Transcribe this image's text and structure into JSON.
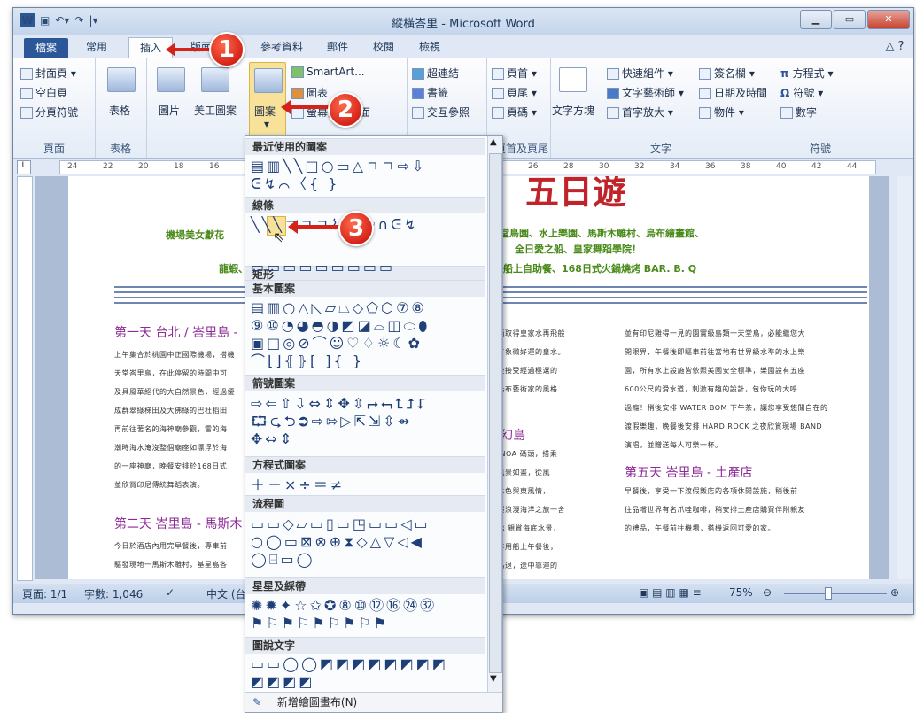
{
  "window": {
    "title": "縱橫峇里 - Microsoft Word"
  },
  "tabs": [
    "檔案",
    "常用",
    "插入",
    "版面配置",
    "參考資料",
    "郵件",
    "校閱",
    "檢視"
  ],
  "ribbon": {
    "page_group": {
      "label": "頁面",
      "items": [
        "封面頁",
        "空白頁",
        "分頁符號"
      ]
    },
    "table_group": {
      "label": "表格",
      "items": [
        "表格"
      ]
    },
    "illus_group": {
      "items": [
        "圖片",
        "美工圖案",
        "圖案",
        "SmartArt...",
        "圖表",
        "螢幕擷取畫面"
      ]
    },
    "links_group": {
      "items": [
        "超連結",
        "書籤",
        "交互參照"
      ]
    },
    "header_group": {
      "label": "頁首及頁尾",
      "items": [
        "頁首",
        "頁尾",
        "頁碼"
      ]
    },
    "text_group": {
      "label": "文字",
      "items": [
        "文字方塊",
        "快速組件",
        "文字藝術師",
        "首字放大",
        "簽名欄",
        "日期及時間",
        "物件"
      ]
    },
    "symbol_group": {
      "label": "符號",
      "items": [
        "方程式",
        "符號",
        "數字"
      ]
    }
  },
  "ruler": {
    "labels": [
      "24",
      "22",
      "20",
      "18",
      "16",
      "14",
      "12",
      "10",
      "14",
      "16",
      "18",
      "22",
      "24",
      "26",
      "28",
      "30",
      "32",
      "34",
      "36",
      "38",
      "40",
      "42",
      "44"
    ]
  },
  "document": {
    "big_title": "五日遊",
    "intro1": "機場美女獻花",
    "intro1b": "天堂鳥園、水上樂園、馬斯木雕村、烏布繪畫館、",
    "intro2": "全日愛之船、皇家舞蹈學院！",
    "intro3a": "龍蝦、",
    "intro3b": "、船上自助餐、168日式火鍋燒烤 BAR. B. Q",
    "day1": "第一天 台北 / 峇里島 -",
    "day2": "第二天 峇里島 - 馬斯木",
    "day5": "第五天 峇里島 - 土產店",
    "dream": "夢幻島",
    "col1": [
      "上午集合於桃園中正國際機場，搭機",
      "天堂峇里島，在此停留的時間中可",
      "及具風華絕代的大自然景色，經過優",
      "成群翠綠梯田及大佛綠的巴杜稻田",
      "再前往著名的海神廟參觀，雷的海",
      "潮時海水淹沒整個廟座如漂浮於海",
      "的一座神廟，晚餐安排於168日式",
      "並欣賞印尼傳統舞蹈表演。"
    ],
    "col1b": [
      "今日於酒店內用完早餐後，專車前",
      "驅發現地一馬斯木雕村，基星島各",
      "彩繪繪，就在陶醉於藝術的世界中"
    ],
    "col2": [
      "光面取得皇家水再飛般",
      "兼享象徵好運的皇水。",
      "餐後接受經過極選的",
      "資烏布藝術家的風格"
    ],
    "col2b": [
      "BENOA 碼頭，搭乘",
      "上風景如畫，從風",
      "光水色與東風情，",
      "度假浪漫海洋之旅一舍",
      "TER 親賞海底水景，",
      "在享用船上午餐後，",
      "難島退，途中靠運的"
    ],
    "col3": [
      "並有印尼雞得一見的園實級島類一天堂鳥，必能繼您大",
      "開眼界，午餐後即驅車前往當地有世界級水準的水上樂",
      "園，所有水上設施皆依照美國安全標準，樂園設有五座",
      "600公尺的滑水道，刺激有趣的設計，包你玩的大呼",
      "過癮！稍後安排 WATER BOM 下午茶，讓您享受悠閒自在的",
      "渡假樂趣，晚餐後安排 HARD ROCK 之夜欣賞現場 BAND",
      "演唱，並贈送每人可樂一杯。"
    ],
    "col3b": [
      "早餐後，享受一下渡假飯店的各項休閒設施，稍後前",
      "往品嚐世界有名爪哇咖啡，稍安排土產店購買伴附親友",
      "的禮品，午餐前往機場，搭機返回可愛的家。"
    ]
  },
  "status": {
    "page": "頁面: 1/1",
    "words": "字數: 1,046",
    "lang": "中文 (台",
    "zoom": "75%"
  },
  "shapes_menu": {
    "sections": [
      "最近使用的圖案",
      "線條",
      "矩形",
      "基本圖案",
      "箭號圖案",
      "方程式圖案",
      "流程圖",
      "星星及綵帶",
      "圖說文字"
    ],
    "rows": {
      "recent": [
        "▤▥╲╲□○▭△ㄱㄱ⇨⇩",
        "ᕮ↯⌒〈{ }"
      ],
      "lines": [
        "╲╲╲ㄱㄱㄱ⌇ㄹ⤷⤶∩ᕮ↯"
      ],
      "rect": [
        "▭▭▭▭▭▭▭▭▭"
      ],
      "basic": [
        "▤▥○△◺▱⏢◇⬠⬡⑦⑧",
        "⑨⑩◔◕◓◑◩◪⌓◫⬭⬮",
        "▣□◎⊘⌒☺♡♢☼☾✿",
        "⌒⌊⌋⦃⦄[ ]{ }"
      ],
      "arrows": [
        "⇨⇦⇧⇩⇔⇕✥⇳⮣⮢⮤⮥⮦",
        "⮔⮎⮌⮊⇨⇰▷⇱⇲⇳⇴",
        "✥⇔⇕"
      ],
      "equation": [
        "＋－×÷＝≠"
      ],
      "flowchart": [
        "▭▭◇▱▭▯▭◳▭▭◁▭",
        "○◯▭⊠⊗⊕⧗◇△▽◁◀",
        "◯⌸▭◯"
      ],
      "stars": [
        "✺✹✦☆✩✪⑧⑩⑫⑯㉔㉜",
        "⚑⚐⚑⚐⚑⚐⚑⚐⚑"
      ],
      "callouts": [
        "▭▭◯◯◩◩◩◩◩◩◩◩",
        "◩◩◩◩"
      ]
    },
    "footer": "新增繪圖畫布(N)"
  },
  "callouts": [
    "1",
    "2",
    "3"
  ],
  "colors": {
    "accent": "#2b579a",
    "callout": "#d6231a"
  }
}
